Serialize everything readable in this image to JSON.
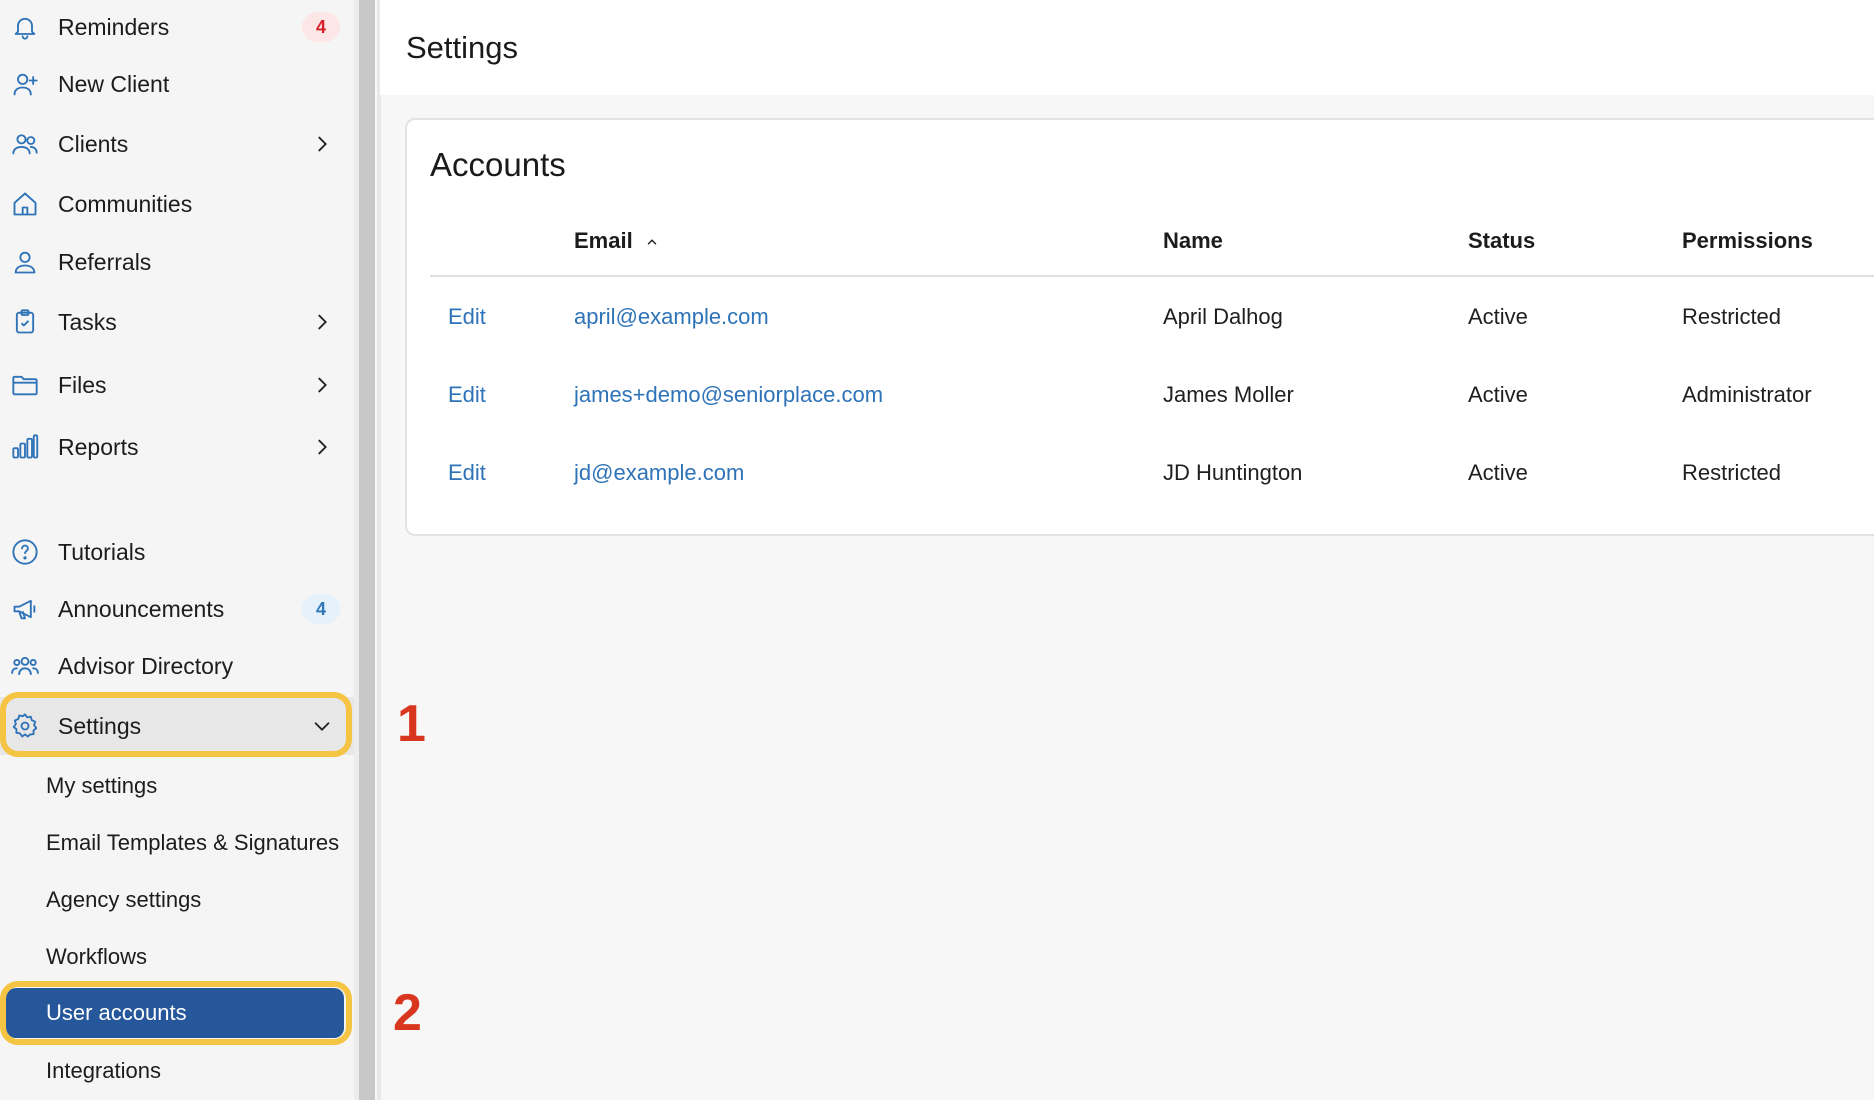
{
  "sidebar": {
    "items": [
      {
        "label": "Reminders",
        "icon": "bell-icon",
        "badge": "4"
      },
      {
        "label": "New Client",
        "icon": "user-plus-icon"
      },
      {
        "label": "Clients",
        "icon": "users-icon"
      },
      {
        "label": "Communities",
        "icon": "home-icon"
      },
      {
        "label": "Referrals",
        "icon": "user-icon"
      },
      {
        "label": "Tasks",
        "icon": "clipboard-icon"
      },
      {
        "label": "Files",
        "icon": "folder-icon"
      },
      {
        "label": "Reports",
        "icon": "bar-chart-icon"
      },
      {
        "label": "Tutorials",
        "icon": "help-circle-icon"
      },
      {
        "label": "Announcements",
        "icon": "megaphone-icon",
        "badge": "4"
      },
      {
        "label": "Advisor Directory",
        "icon": "people-group-icon"
      },
      {
        "label": "Settings",
        "icon": "gear-icon"
      }
    ],
    "settings_sub": [
      {
        "label": "My settings"
      },
      {
        "label": "Email Templates & Signatures"
      },
      {
        "label": "Agency settings"
      },
      {
        "label": "Workflows"
      },
      {
        "label": "User accounts"
      },
      {
        "label": "Integrations"
      }
    ]
  },
  "annotations": {
    "step1": "1",
    "step2": "2"
  },
  "page": {
    "title": "Settings"
  },
  "accounts": {
    "title": "Accounts",
    "columns": {
      "email": "Email",
      "name": "Name",
      "status": "Status",
      "permissions": "Permissions"
    },
    "rows": [
      {
        "action": "Edit",
        "email": "april@example.com",
        "name": "April Dalhog",
        "status": "Active",
        "permissions": "Restricted"
      },
      {
        "action": "Edit",
        "email": "james+demo@seniorplace.com",
        "name": "James Moller",
        "status": "Active",
        "permissions": "Administrator"
      },
      {
        "action": "Edit",
        "email": "jd@example.com",
        "name": "JD Huntington",
        "status": "Active",
        "permissions": "Restricted"
      }
    ]
  },
  "colors": {
    "accent": "#25579a",
    "link": "#2e73b8",
    "highlight": "#f6c443",
    "annotation": "#d8361f"
  }
}
